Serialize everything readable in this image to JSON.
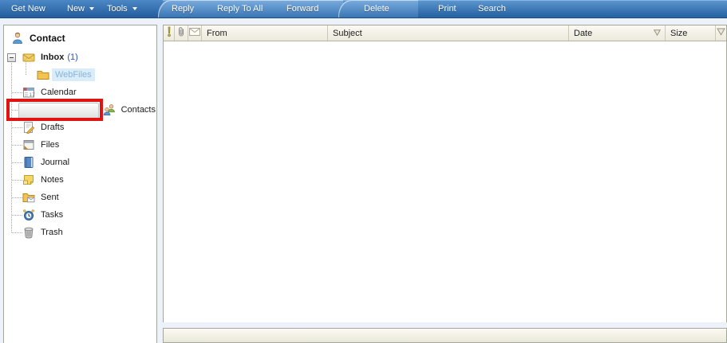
{
  "toolbar": {
    "get_new": "Get New",
    "new": "New",
    "tools": "Tools",
    "reply": "Reply",
    "reply_to_all": "Reply To All",
    "forward": "Forward",
    "delete": "Delete",
    "print": "Print",
    "search": "Search"
  },
  "sidebar": {
    "title": "Contact",
    "tree": [
      {
        "label": "Inbox",
        "count": "(1)",
        "icon": "inbox-icon"
      },
      {
        "label": "WebFiles",
        "icon": "folder-icon"
      },
      {
        "label": "Calendar",
        "icon": "calendar-icon"
      },
      {
        "label": "Contacts",
        "icon": "contacts-icon"
      },
      {
        "label": "Drafts",
        "icon": "drafts-icon"
      },
      {
        "label": "Files",
        "icon": "files-icon"
      },
      {
        "label": "Journal",
        "icon": "journal-icon"
      },
      {
        "label": "Notes",
        "icon": "notes-icon"
      },
      {
        "label": "Sent",
        "icon": "sent-icon"
      },
      {
        "label": "Tasks",
        "icon": "tasks-icon"
      },
      {
        "label": "Trash",
        "icon": "trash-icon"
      }
    ]
  },
  "message_list": {
    "columns": {
      "from": "From",
      "subject": "Subject",
      "date": "Date",
      "size": "Size"
    },
    "icon_columns": [
      "importance-icon",
      "paperclip-icon",
      "envelope-icon"
    ],
    "sort": {
      "column": "Date",
      "direction": "desc"
    },
    "rows": []
  },
  "annotation": {
    "shape": "rectangle",
    "color": "#e01212",
    "highlights": "Contacts"
  },
  "colors": {
    "toolbar_blue": "#3a76b4",
    "selection_highlight": "#d8ecfa",
    "annotation_red": "#e01212",
    "header_cream": "#f6f4ea"
  }
}
